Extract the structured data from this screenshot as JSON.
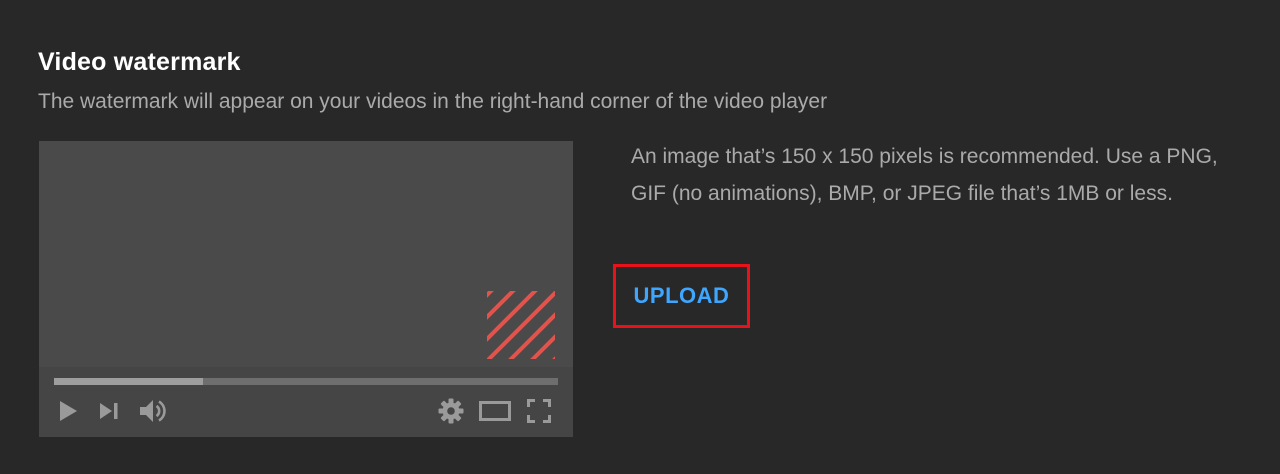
{
  "section": {
    "title": "Video watermark",
    "description": "The watermark will appear on your videos in the right-hand corner of the video player"
  },
  "player_preview": {
    "progress_fraction": 0.295,
    "watermark_color": "#e8514a",
    "controls": [
      "play-icon",
      "next-icon",
      "volume-icon",
      "settings-icon",
      "theater-icon",
      "fullscreen-icon"
    ]
  },
  "info": {
    "text": "An image that’s 150 x 150 pixels is recommended. Use a PNG, GIF (no animations), BMP, or JPEG file that’s 1MB or less."
  },
  "actions": {
    "upload_label": "UPLOAD",
    "upload_color": "#3ea6ff",
    "highlight_color": "#e8121b"
  }
}
